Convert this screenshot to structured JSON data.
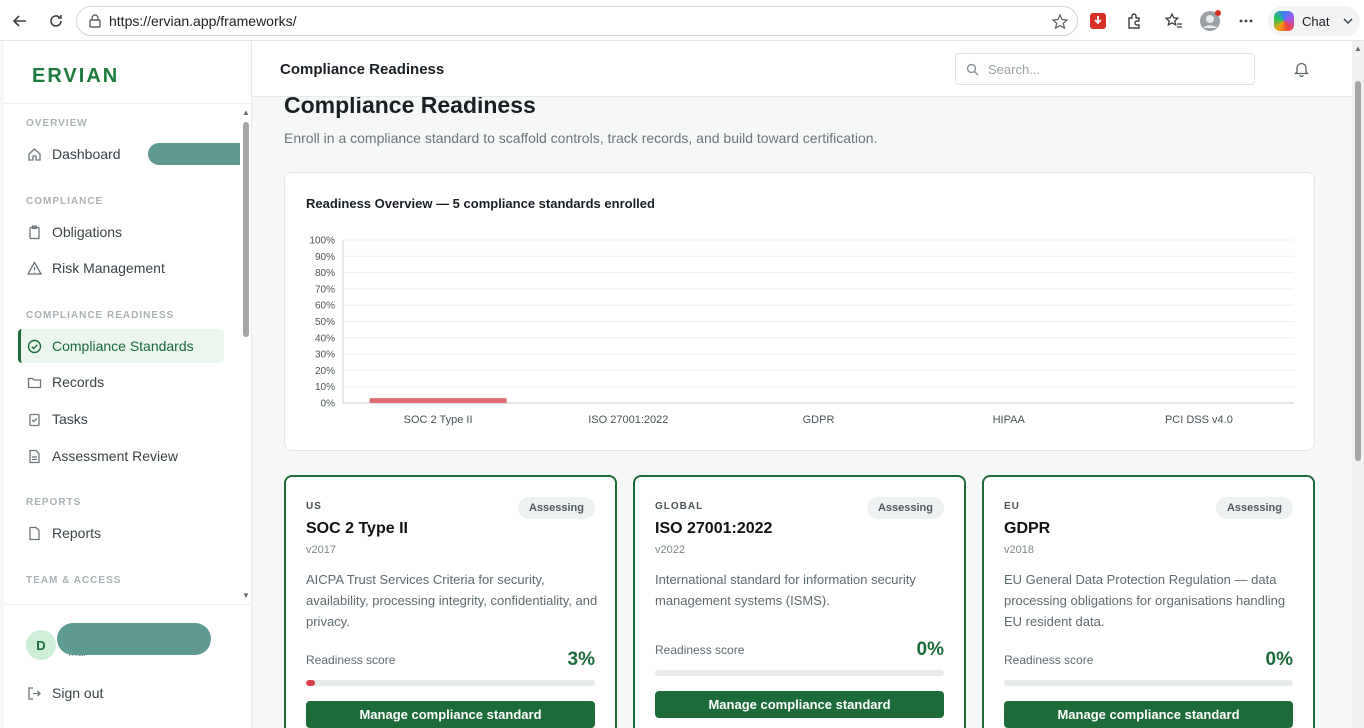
{
  "browser": {
    "url": "https://ervian.app/frameworks/",
    "chat_label": "Chat"
  },
  "sidebar": {
    "brand": "ERVIAN",
    "sections": [
      {
        "label": "OVERVIEW"
      },
      {
        "label": "COMPLIANCE"
      },
      {
        "label": "COMPLIANCE READINESS"
      },
      {
        "label": "REPORTS"
      },
      {
        "label": "TEAM & ACCESS"
      }
    ],
    "items": [
      {
        "label": "Dashboard",
        "icon": "home-icon"
      },
      {
        "label": "Obligations",
        "icon": "clipboard-icon"
      },
      {
        "label": "Risk Management",
        "icon": "warning-icon"
      },
      {
        "label": "Compliance Standards",
        "icon": "check-circle-icon",
        "active": true
      },
      {
        "label": "Records",
        "icon": "folder-icon"
      },
      {
        "label": "Tasks",
        "icon": "task-icon"
      },
      {
        "label": "Assessment Review",
        "icon": "document-icon"
      },
      {
        "label": "Reports",
        "icon": "report-icon"
      }
    ],
    "user": {
      "initial": "D",
      "role": "Inar"
    },
    "signout_label": "Sign out"
  },
  "header": {
    "title": "Compliance Readiness",
    "search_placeholder": "Search..."
  },
  "main": {
    "title": "Compliance Readiness",
    "subtitle": "Enroll in a compliance standard to scaffold controls, track records, and build toward certification."
  },
  "chart_data": {
    "type": "bar",
    "title": "Readiness Overview — 5 compliance standards enrolled",
    "categories": [
      "SOC 2 Type II",
      "ISO 27001:2022",
      "GDPR",
      "HIPAA",
      "PCI DSS v4.0"
    ],
    "values": [
      3,
      0,
      0,
      0,
      0
    ],
    "ylim": [
      0,
      100
    ],
    "yticks": [
      "0%",
      "10%",
      "20%",
      "30%",
      "40%",
      "50%",
      "60%",
      "70%",
      "80%",
      "90%",
      "100%"
    ],
    "grid": true,
    "bar_color": "#e06b73"
  },
  "frameworks": [
    {
      "region": "US",
      "status": "Assessing",
      "name": "SOC 2 Type II",
      "version": "v2017",
      "description": "AICPA Trust Services Criteria for security, availability, processing integrity, confidentiality, and privacy.",
      "score_label": "Readiness score",
      "score": "3%",
      "score_value": 3,
      "button": "Manage compliance standard"
    },
    {
      "region": "GLOBAL",
      "status": "Assessing",
      "name": "ISO 27001:2022",
      "version": "v2022",
      "description": "International standard for information security management systems (ISMS).",
      "score_label": "Readiness score",
      "score": "0%",
      "score_value": 0,
      "button": "Manage compliance standard"
    },
    {
      "region": "EU",
      "status": "Assessing",
      "name": "GDPR",
      "version": "v2018",
      "description": "EU General Data Protection Regulation — data processing obligations for organisations handling EU resident data.",
      "score_label": "Readiness score",
      "score": "0%",
      "score_value": 0,
      "button": "Manage compliance standard"
    }
  ],
  "colors": {
    "brand": "#1b7a3c",
    "accent": "#1e6b3a",
    "danger": "#d8414b"
  }
}
